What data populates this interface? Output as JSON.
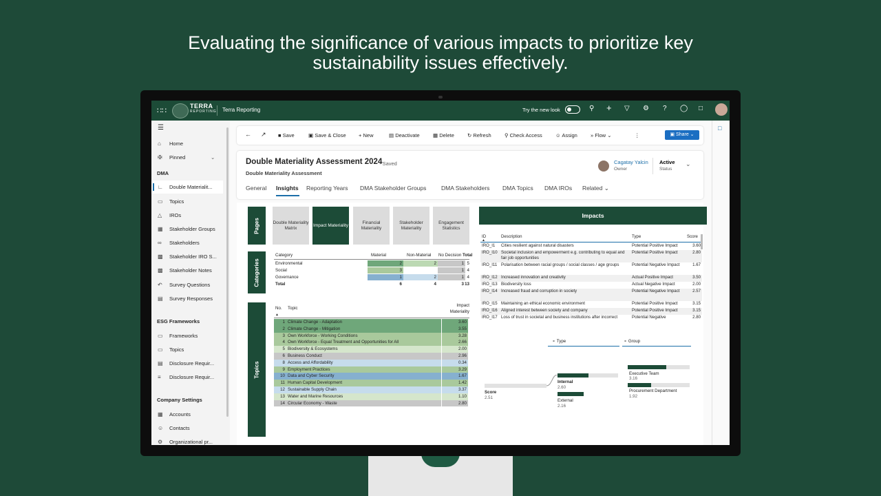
{
  "headline": {
    "line1": "Evaluating the significance of various impacts to prioritize key",
    "line2": "sustainability issues effectively."
  },
  "topbar": {
    "logo_text": "TERRA",
    "logo_sub": "REPORTING",
    "app_name": "Terra Reporting",
    "try_new_look": "Try the new look",
    "icons": [
      "search-icon",
      "add-icon",
      "filter-icon",
      "settings-icon",
      "help-icon",
      "copilot-icon",
      "chat-icon"
    ]
  },
  "sidebar": {
    "home": "Home",
    "pinned": "Pinned",
    "section_dma": "DMA",
    "dma_items": [
      "Double Materialit...",
      "Topics",
      "IROs",
      "Stakeholder Groups",
      "Stakeholders",
      "Stakeholder IRO S...",
      "Stakeholder Notes",
      "Survey Questions",
      "Survey Responses"
    ],
    "section_esg": "ESG Frameworks",
    "esg_items": [
      "Frameworks",
      "Topics",
      "Disclosure Requir...",
      "Disclosure Requir..."
    ],
    "section_company": "Company Settings",
    "company_items": [
      "Accounts",
      "Contacts",
      "Organizational pr..."
    ]
  },
  "commandbar": {
    "save": "Save",
    "save_close": "Save & Close",
    "new": "New",
    "deactivate": "Deactivate",
    "delete": "Delete",
    "refresh": "Refresh",
    "check_access": "Check Access",
    "assign": "Assign",
    "flow": "Flow",
    "share": "Share"
  },
  "record": {
    "title": "Double Materiality Assessment 2024",
    "saved": "- Saved",
    "entity": "Double Materiality Assessment",
    "owner_name": "Cagatay Yalcin",
    "owner_label": "Owner",
    "status": "Active",
    "status_label": "Status"
  },
  "tabs": [
    "General",
    "Insights",
    "Reporting Years",
    "DMA Stakeholder Groups",
    "DMA Stakeholders",
    "DMA Topics",
    "DMA IROs",
    "Related"
  ],
  "report": {
    "side_labels": {
      "pages": "Pages",
      "categories": "Categories",
      "topics": "Topics"
    },
    "pages": [
      {
        "label": "Double Materiality Matrix",
        "active": false
      },
      {
        "label": "Impact Materiality",
        "active": true
      },
      {
        "label": "Financial Materiality",
        "active": false
      },
      {
        "label": "Stakeholder Materiality",
        "active": false
      },
      {
        "label": "Engagement Statistics",
        "active": false
      }
    ],
    "category_table": {
      "headers": [
        "Category",
        "Material",
        "Non-Material",
        "No Decision",
        "Total"
      ],
      "rows": [
        [
          "Environmental",
          "2",
          "2",
          "1",
          "5"
        ],
        [
          "Social",
          "3",
          "",
          "1",
          "4"
        ],
        [
          "Governance",
          "1",
          "2",
          "1",
          "4"
        ],
        [
          "Total",
          "6",
          "4",
          "3",
          "13"
        ]
      ]
    },
    "topics_table": {
      "headers": [
        "No.",
        "Topic",
        "Impact",
        "Materiality"
      ],
      "rows": [
        [
          "1",
          "Climate Change - Adaptation",
          "3.60",
          "#6fa77a"
        ],
        [
          "2",
          "Climate Change - Mitigation",
          "3.55",
          "#6fa77a"
        ],
        [
          "3",
          "Own Workforce - Working Conditions",
          "3.28",
          "#a9c99c"
        ],
        [
          "4",
          "Own Workforce - Equal Treatment and Opportunities for All",
          "2.66",
          "#a9c99c"
        ],
        [
          "5",
          "Biodiversity & Ecosystems",
          "2.00",
          "#d5e6cc"
        ],
        [
          "6",
          "Business Conduct",
          "2.96",
          "#c7c7c7"
        ],
        [
          "8",
          "Access and Affordability",
          "0.34",
          "#c6dcec"
        ],
        [
          "9",
          "Employment Practices",
          "3.29",
          "#a9c99c"
        ],
        [
          "10",
          "Data and Cyber Security",
          "1.67",
          "#86b0cf"
        ],
        [
          "11",
          "Human Capital Development",
          "1.42",
          "#a9c99c"
        ],
        [
          "12",
          "Sustainable Supply Chain",
          "3.37",
          "#c6dcec"
        ],
        [
          "13",
          "Water and Marine Resources",
          "1.10",
          "#d5e6cc"
        ],
        [
          "14",
          "Circular Economy - Waste",
          "2.80",
          "#c7c7c7"
        ]
      ]
    },
    "impacts": {
      "title": "Impacts",
      "headers": [
        "ID",
        "Description",
        "Type",
        "Score"
      ],
      "rows": [
        [
          "IRO_I1",
          "Cities resilient against natural disasters",
          "Potential Positive Impact",
          "3.60"
        ],
        [
          "IRO_I10",
          "Societal inclusion and empowerment e.g. contributing to equal and fair job opportunities",
          "Potential Positive Impact",
          "2.80"
        ],
        [
          "IRO_I11",
          "Polarisation between racial groups / social classes / age groups",
          "Potential Negative Impact",
          "1.67"
        ],
        [
          "IRO_I12",
          "Increased innovation and creativity",
          "Actual Positive Impact",
          "3.50"
        ],
        [
          "IRO_I13",
          "Biodiversity loss",
          "Actual Negative Impact",
          "2.00"
        ],
        [
          "IRO_I14",
          "Increased fraud and corruption in society",
          "Potential Negative Impact",
          "2.57"
        ],
        [
          "IRO_I15",
          "Maintaining an ethical economic environment",
          "Potential Positive Impact",
          "3.15"
        ],
        [
          "IRO_I16",
          "Aligned interest between society and company",
          "Potential Positive Impact",
          "3.15"
        ],
        [
          "IRO_I17",
          "Loss of trust in societal and business institutions after incorrect",
          "Potential Negative",
          "2.80"
        ]
      ]
    },
    "tree": {
      "filter_type": "Type",
      "filter_group": "Group",
      "root_label": "Score",
      "root_value": "2.51",
      "internal_label": "Internal",
      "internal_value": "2.60",
      "external_label": "External",
      "external_value": "2.16",
      "exec_label": "Executive Team",
      "exec_value": "3.16",
      "proc_label": "Procurement Department",
      "proc_value": "1.92"
    }
  }
}
